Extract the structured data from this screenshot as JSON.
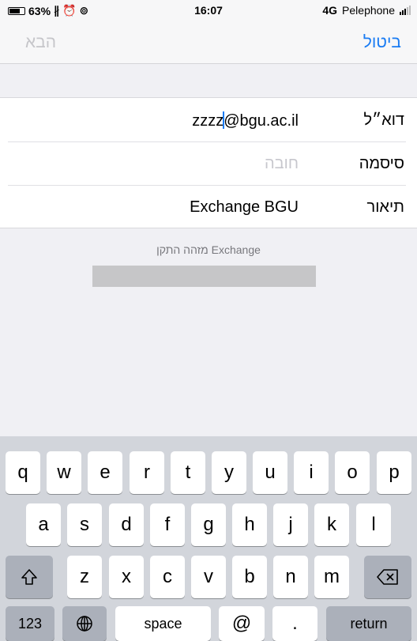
{
  "status_bar": {
    "battery_percent": "63%",
    "battery_level": 0.63,
    "icons": [
      "bluetooth-icon",
      "alarm-icon",
      "rotation-lock-icon"
    ],
    "time": "16:07",
    "network": "4G",
    "carrier": "Pelephone"
  },
  "nav": {
    "cancel_label": "ביטול",
    "next_label": "הבא",
    "accent_color": "#1a7cf3"
  },
  "form": {
    "email": {
      "label": "דוא״ל",
      "value_before_cursor": "zzzz",
      "value_after_cursor": "@bgu.ac.il"
    },
    "password": {
      "label": "סיסמה",
      "placeholder": "חובה"
    },
    "description": {
      "label": "תיאור",
      "value": "Exchange BGU"
    }
  },
  "device_id": {
    "label": "מזהה התקן Exchange"
  },
  "keyboard": {
    "row1": [
      "q",
      "w",
      "e",
      "r",
      "t",
      "y",
      "u",
      "i",
      "o",
      "p"
    ],
    "row2": [
      "a",
      "s",
      "d",
      "f",
      "g",
      "h",
      "j",
      "k",
      "l"
    ],
    "row3": [
      "z",
      "x",
      "c",
      "v",
      "b",
      "n",
      "m"
    ],
    "shift_icon": "shift-icon",
    "delete_icon": "delete-icon",
    "numbers_label": "123",
    "globe_icon": "globe-icon",
    "space_label": "space",
    "at_label": "@",
    "dot_label": ".",
    "return_label": "return"
  }
}
